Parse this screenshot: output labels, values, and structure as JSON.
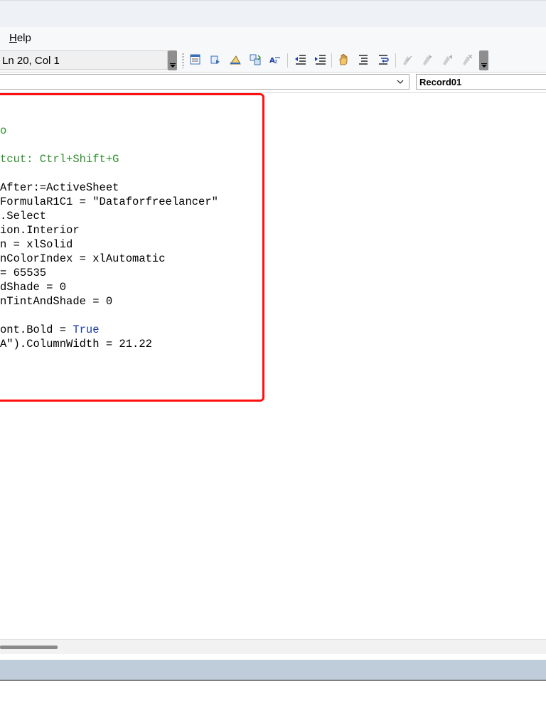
{
  "menu": {
    "help_label": "Help",
    "help_accel": "H",
    "help_rest": "elp"
  },
  "toolbar": {
    "status_text": "Ln 20, Col 1",
    "buttons": [
      "properties-window",
      "object-browser",
      "toolbox",
      "project-explorer",
      "quick-info",
      "outdent",
      "indent",
      "toggle-breakpoint",
      "comment-block",
      "uncomment-block",
      "toggle-bookmark",
      "next-bookmark",
      "previous-bookmark",
      "clear-all-bookmarks"
    ]
  },
  "selectors": {
    "object_value": "",
    "procedure_value": "Record01"
  },
  "code": {
    "lines": [
      {
        "segments": [
          {
            "t": "o",
            "c": "green"
          }
        ]
      },
      {
        "segments": [
          {
            "t": "tcut: Ctrl+Shift+G",
            "c": "green"
          }
        ]
      },
      {
        "segments": [
          {
            "t": "After:=ActiveSheet",
            "c": "black"
          }
        ]
      },
      {
        "segments": [
          {
            "t": "FormulaR1C1 = \"Dataforfreelancer\"",
            "c": "black"
          }
        ]
      },
      {
        "segments": [
          {
            "t": ".Select",
            "c": "black"
          }
        ]
      },
      {
        "segments": [
          {
            "t": "ion.Interior",
            "c": "black"
          }
        ]
      },
      {
        "segments": [
          {
            "t": "n = xlSolid",
            "c": "black"
          }
        ]
      },
      {
        "segments": [
          {
            "t": "nColorIndex = xlAutomatic",
            "c": "black"
          }
        ]
      },
      {
        "segments": [
          {
            "t": "= 65535",
            "c": "black"
          }
        ]
      },
      {
        "segments": [
          {
            "t": "dShade = 0",
            "c": "black"
          }
        ]
      },
      {
        "segments": [
          {
            "t": "nTintAndShade = 0",
            "c": "black"
          }
        ]
      },
      {
        "segments": [
          {
            "t": "ont.Bold = ",
            "c": "black"
          },
          {
            "t": "True",
            "c": "blue"
          }
        ]
      },
      {
        "segments": [
          {
            "t": "A\").ColumnWidth = 21.22",
            "c": "black"
          }
        ]
      }
    ]
  },
  "colors": {
    "highlight": "#ff1010",
    "comment": "#2f8f2f",
    "keyword": "#1a3aa8",
    "immediate_bar": "#bfcdda"
  }
}
